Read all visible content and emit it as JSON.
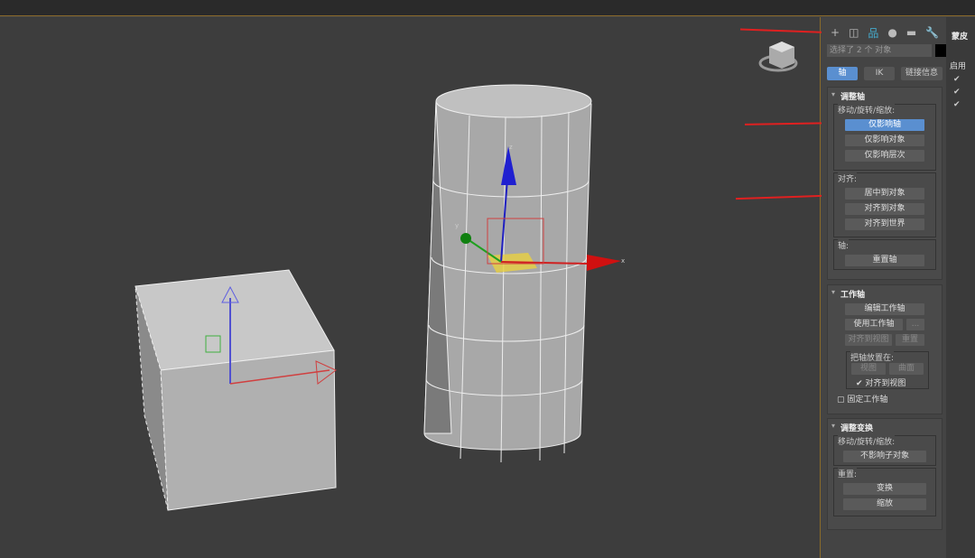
{
  "command_panel": {
    "tabs": [
      "create",
      "modify",
      "hierarchy",
      "motion",
      "display",
      "utilities"
    ],
    "selection_text": "选择了 2 个 对象",
    "subtabs": [
      "轴",
      "IK",
      "链接信息"
    ],
    "adjust_pivot": {
      "title": "调整轴",
      "move_group": "移动/旋转/缩放:",
      "affect_pivot_only": "仅影响轴",
      "affect_object_only": "仅影响对象",
      "affect_hierarchy_only": "仅影响层次",
      "align_group": "对齐:",
      "center_to_object": "居中到对象",
      "align_to_object": "对齐到对象",
      "align_to_world": "对齐到世界",
      "pivot_group": "轴:",
      "reset_pivot": "重置轴"
    },
    "working_pivot": {
      "title": "工作轴",
      "edit": "编辑工作轴",
      "use": "使用工作轴",
      "more": "...",
      "align_to_view": "对齐到视图",
      "reset": "重置",
      "place_group": "把轴放置在:",
      "view": "视图",
      "surface": "曲面",
      "align_to_view_check": "对齐到视图",
      "lock": "固定工作轴"
    },
    "adjust_transform": {
      "title": "调整变换",
      "move_group": "移动/旋转/缩放:",
      "dont_affect_children": "不影响子对象",
      "reset_group": "重置:",
      "transform": "变换",
      "scale": "缩放"
    }
  },
  "side_panel": {
    "title": "蒙皮",
    "enable": "启用"
  },
  "viewport": {
    "axis_x": "x",
    "axis_y": "y",
    "axis_z": "z"
  }
}
